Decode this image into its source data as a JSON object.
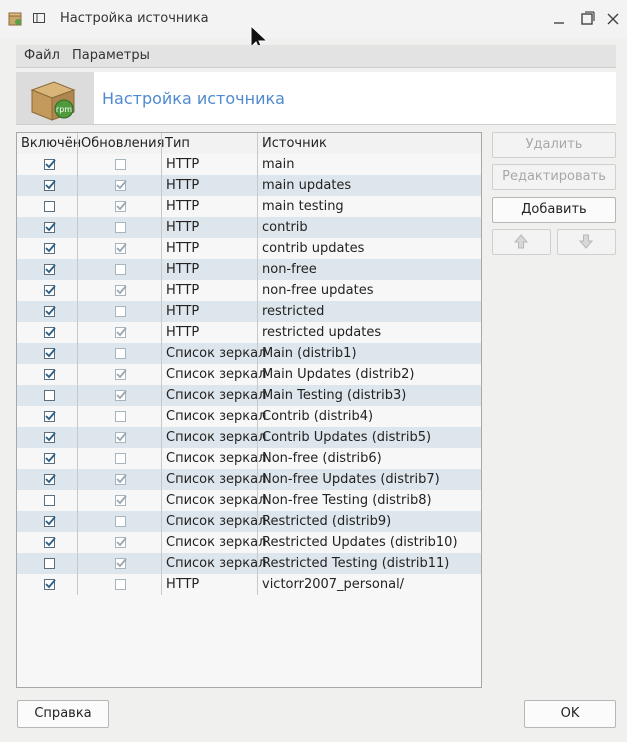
{
  "window": {
    "title": "Настройка источника"
  },
  "menu": {
    "file": "Файл",
    "params": "Параметры"
  },
  "banner": {
    "title": "Настройка источника",
    "icon": "rpm-package-icon"
  },
  "table": {
    "headers": {
      "enabled": "Включён",
      "updates": "Обновления",
      "type": "Тип",
      "source": "Источник"
    },
    "rows": [
      {
        "enabled": true,
        "updates": false,
        "type": "HTTP",
        "source": "main"
      },
      {
        "enabled": true,
        "updates": true,
        "type": "HTTP",
        "source": "main updates"
      },
      {
        "enabled": false,
        "updates": true,
        "type": "HTTP",
        "source": "main testing"
      },
      {
        "enabled": true,
        "updates": false,
        "type": "HTTP",
        "source": "contrib"
      },
      {
        "enabled": true,
        "updates": true,
        "type": "HTTP",
        "source": "contrib updates"
      },
      {
        "enabled": true,
        "updates": false,
        "type": "HTTP",
        "source": "non-free"
      },
      {
        "enabled": true,
        "updates": true,
        "type": "HTTP",
        "source": "non-free updates"
      },
      {
        "enabled": true,
        "updates": false,
        "type": "HTTP",
        "source": "restricted"
      },
      {
        "enabled": true,
        "updates": true,
        "type": "HTTP",
        "source": "restricted updates"
      },
      {
        "enabled": true,
        "updates": false,
        "type": "Список зеркал",
        "source": "Main (distrib1)"
      },
      {
        "enabled": true,
        "updates": true,
        "type": "Список зеркал",
        "source": "Main Updates (distrib2)"
      },
      {
        "enabled": false,
        "updates": true,
        "type": "Список зеркал",
        "source": "Main Testing (distrib3)"
      },
      {
        "enabled": true,
        "updates": false,
        "type": "Список зеркал",
        "source": "Contrib (distrib4)"
      },
      {
        "enabled": true,
        "updates": true,
        "type": "Список зеркал",
        "source": "Contrib Updates (distrib5)"
      },
      {
        "enabled": true,
        "updates": false,
        "type": "Список зеркал",
        "source": "Non-free (distrib6)"
      },
      {
        "enabled": true,
        "updates": true,
        "type": "Список зеркал",
        "source": "Non-free Updates (distrib7)"
      },
      {
        "enabled": false,
        "updates": true,
        "type": "Список зеркал",
        "source": "Non-free Testing (distrib8)"
      },
      {
        "enabled": true,
        "updates": false,
        "type": "Список зеркал",
        "source": "Restricted (distrib9)"
      },
      {
        "enabled": true,
        "updates": true,
        "type": "Список зеркал",
        "source": "Restricted Updates (distrib10)"
      },
      {
        "enabled": false,
        "updates": true,
        "type": "Список зеркал",
        "source": "Restricted Testing (distrib11)"
      },
      {
        "enabled": true,
        "updates": false,
        "type": "HTTP",
        "source": "victorr2007_personal/"
      }
    ]
  },
  "buttons": {
    "delete": "Удалить",
    "edit": "Редактировать",
    "add": "Добавить",
    "help": "Справка",
    "ok": "OK"
  },
  "colors": {
    "accent": "#4f8ad0",
    "row_alt": "#dde6ec"
  }
}
